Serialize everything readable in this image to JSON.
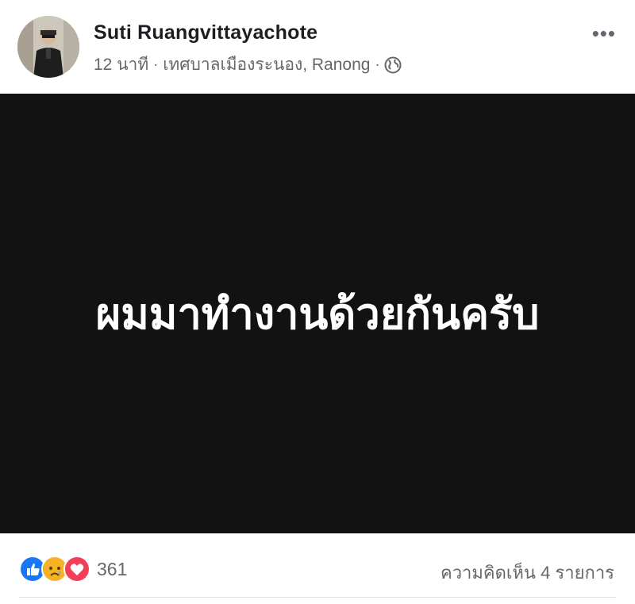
{
  "post": {
    "author": "Suti Ruangvittayachote",
    "time": "12 นาที",
    "separator": "·",
    "location": "เทศบาลเมืองระนอง, Ranong",
    "privacy_icon": "globe-icon",
    "more_icon": "more-options-icon",
    "more_label": "•••",
    "image_text": "ผมมาทำงานด้วยกันครับ",
    "image_background": "#121212"
  },
  "footer": {
    "reactions": [
      "like-reaction-icon",
      "sad-reaction-icon",
      "love-reaction-icon"
    ],
    "reaction_count": "361",
    "comments_label": "ความคิดเห็น 4 รายการ"
  },
  "colors": {
    "like": "#1877f2",
    "sad": "#f7b125",
    "love": "#f33e58",
    "secondary_text": "#65676b"
  }
}
